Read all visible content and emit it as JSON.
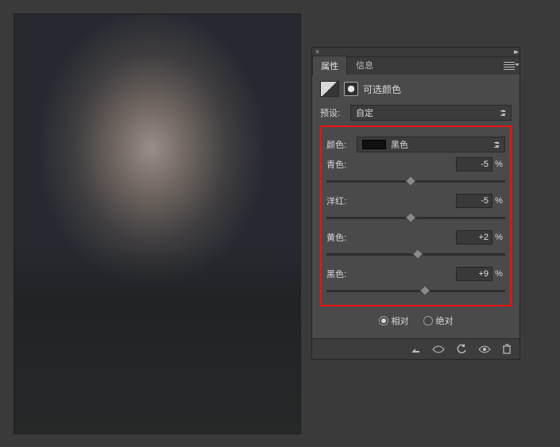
{
  "tabs": {
    "properties": "属性",
    "info": "信息"
  },
  "panel_title": "可选颜色",
  "preset": {
    "label": "预设:",
    "value": "自定"
  },
  "color": {
    "label": "颜色:",
    "value": "黑色"
  },
  "sliders": {
    "cyan": {
      "label": "青色:",
      "value": "-5",
      "unit": "%",
      "pos": 47
    },
    "magenta": {
      "label": "洋红:",
      "value": "-5",
      "unit": "%",
      "pos": 47
    },
    "yellow": {
      "label": "黄色:",
      "value": "+2",
      "unit": "%",
      "pos": 51
    },
    "black": {
      "label": "黑色:",
      "value": "+9",
      "unit": "%",
      "pos": 55
    }
  },
  "method": {
    "relative": "相对",
    "absolute": "绝对",
    "selected": "relative"
  }
}
